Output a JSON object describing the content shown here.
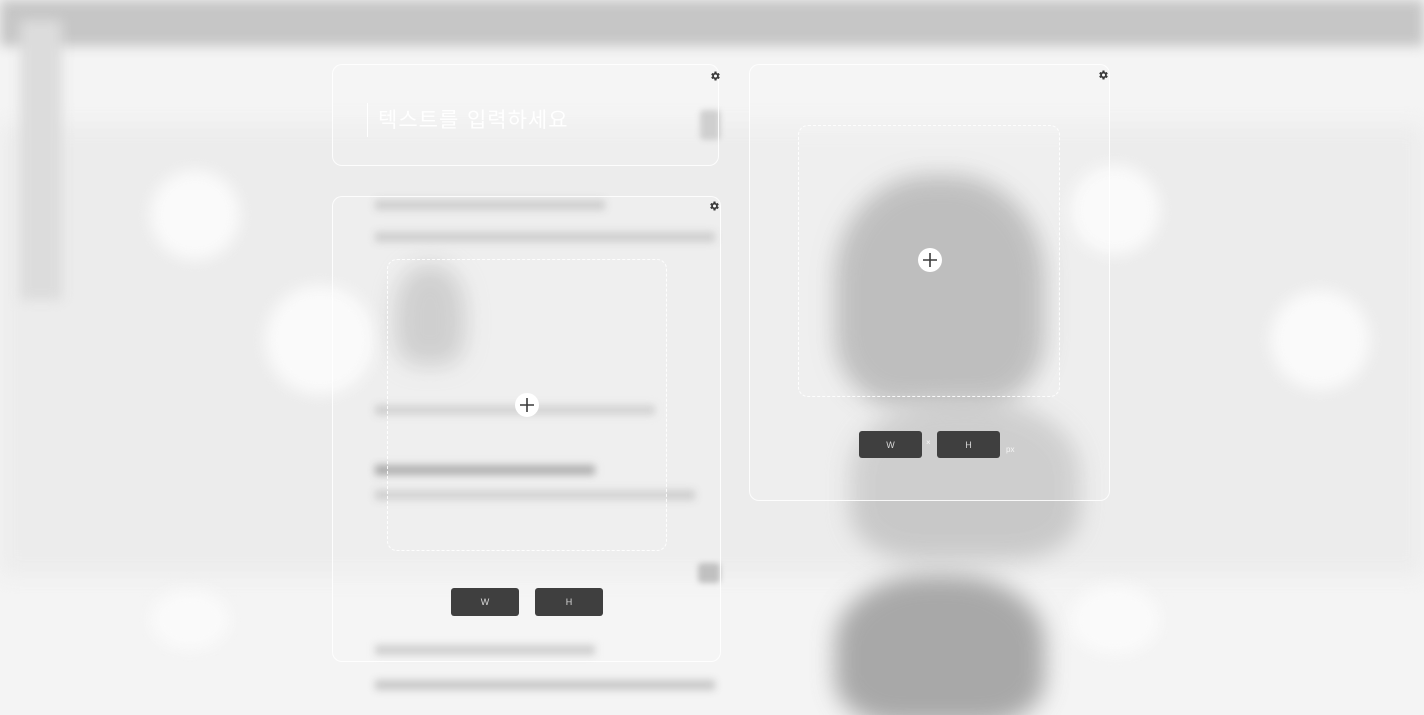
{
  "text_widget": {
    "placeholder": "텍스트를 입력하세요",
    "value": ""
  },
  "image_widget_left": {
    "width_button": "W",
    "height_button": "H"
  },
  "image_widget_right": {
    "width_button": "W",
    "height_button": "H",
    "separator": "×",
    "unit": "px"
  },
  "icons": {
    "settings": "gear-icon",
    "add_image": "plus-icon"
  },
  "colors": {
    "button_bg": "#3f3f3f",
    "button_text": "#d9d9d9",
    "widget_border": "#ffffff"
  }
}
